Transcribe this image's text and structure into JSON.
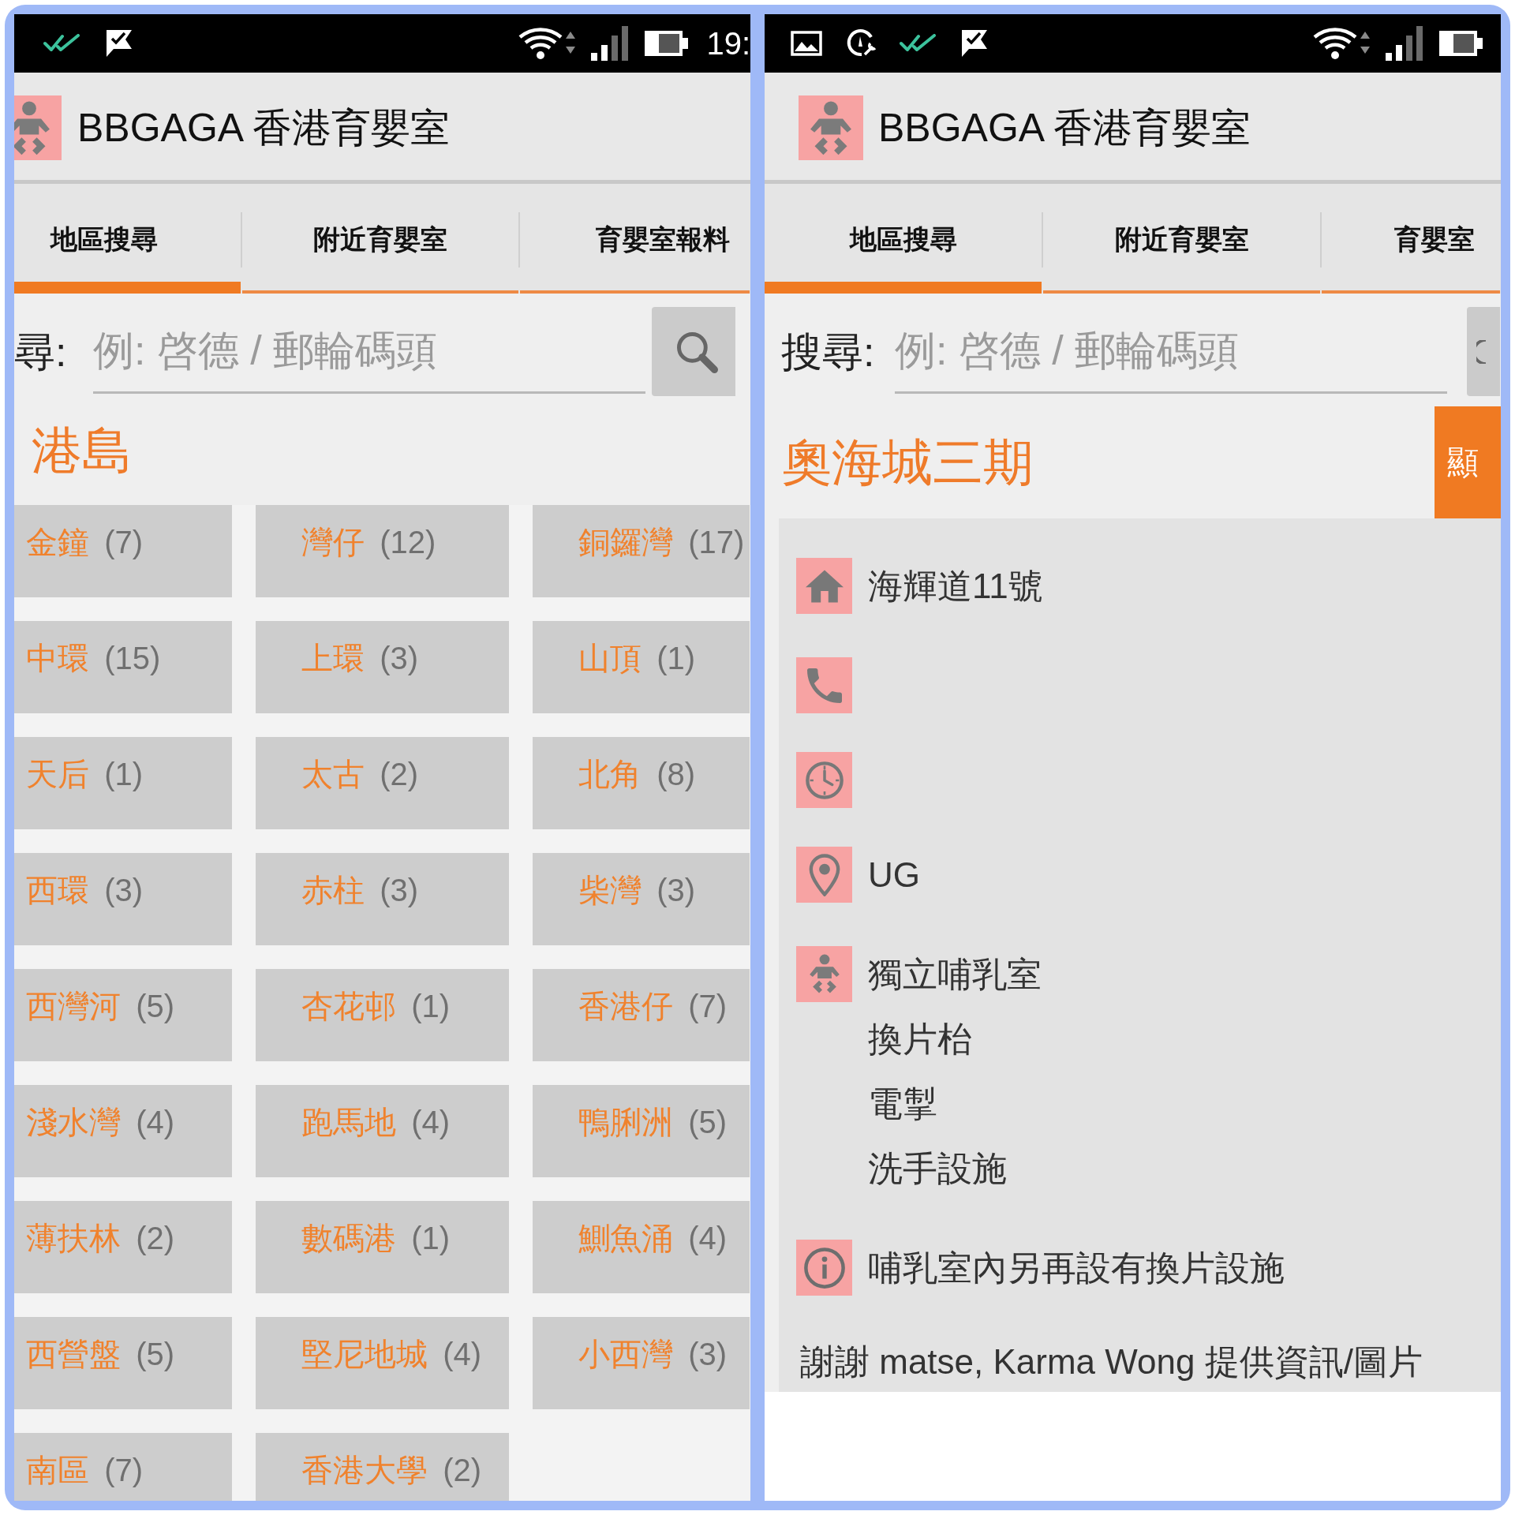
{
  "panels": [
    {
      "kind": "district_list",
      "status_bar": {
        "time": "19:"
      },
      "header": {
        "title": "BBGAGA 香港育嬰室"
      },
      "tabs": [
        {
          "label": "地區搜尋",
          "selected": true
        },
        {
          "label": "附近育嬰室",
          "selected": false
        },
        {
          "label": "育嬰室報料",
          "selected": false
        }
      ],
      "search": {
        "label": "尋:",
        "placeholder": "例: 啓德 / 郵輪碼頭"
      },
      "section_title": "港島",
      "districts": [
        {
          "name": "金鐘",
          "count": "(7)"
        },
        {
          "name": "灣仔",
          "count": "(12)"
        },
        {
          "name": "銅鑼灣",
          "count": "(17)"
        },
        {
          "name": "中環",
          "count": "(15)"
        },
        {
          "name": "上環",
          "count": "(3)"
        },
        {
          "name": "山頂",
          "count": "(1)"
        },
        {
          "name": "天后",
          "count": "(1)"
        },
        {
          "name": "太古",
          "count": "(2)"
        },
        {
          "name": "北角",
          "count": "(8)"
        },
        {
          "name": "西環",
          "count": "(3)"
        },
        {
          "name": "赤柱",
          "count": "(3)"
        },
        {
          "name": "柴灣",
          "count": "(3)"
        },
        {
          "name": "西灣河",
          "count": "(5)"
        },
        {
          "name": "杏花邨",
          "count": "(1)"
        },
        {
          "name": "香港仔",
          "count": "(7)"
        },
        {
          "name": "淺水灣",
          "count": "(4)"
        },
        {
          "name": "跑馬地",
          "count": "(4)"
        },
        {
          "name": "鴨脷洲",
          "count": "(5)"
        },
        {
          "name": "薄扶林",
          "count": "(2)"
        },
        {
          "name": "數碼港",
          "count": "(1)"
        },
        {
          "name": "鰂魚涌",
          "count": "(4)"
        },
        {
          "name": "西營盤",
          "count": "(5)"
        },
        {
          "name": "堅尼地城",
          "count": "(4)"
        },
        {
          "name": "小西灣",
          "count": "(3)"
        },
        {
          "name": "南區",
          "count": "(7)"
        },
        {
          "name": "香港大學",
          "count": "(2)"
        }
      ]
    },
    {
      "kind": "room_detail",
      "header": {
        "title": "BBGAGA 香港育嬰室"
      },
      "tabs": [
        {
          "label": "地區搜尋",
          "selected": true
        },
        {
          "label": "附近育嬰室",
          "selected": false
        },
        {
          "label": "育嬰室",
          "selected": false
        }
      ],
      "search": {
        "label": "搜尋:",
        "placeholder": "例: 啓德 / 郵輪碼頭"
      },
      "section_title": "奧海城三期",
      "show_button": "顯",
      "rows": [
        {
          "kind": "address",
          "lines": [
            "海輝道11號"
          ]
        },
        {
          "kind": "phone"
        },
        {
          "kind": "hours"
        },
        {
          "kind": "floor",
          "lines": [
            "UG"
          ]
        },
        {
          "kind": "facilities",
          "lines": [
            "獨立哺乳室",
            "換片枱",
            "電掣",
            "洗手設施"
          ]
        },
        {
          "kind": "note",
          "lines": [
            "哺乳室內另再設有換片設施"
          ]
        }
      ],
      "credit": "謝謝 matse, Karma Wong 提供資訊/圖片"
    }
  ]
}
